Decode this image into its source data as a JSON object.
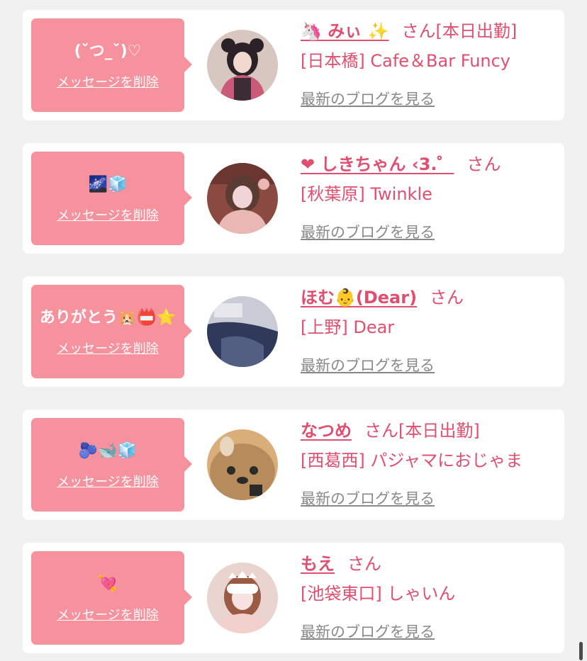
{
  "common": {
    "delete_label": "メッセージを削除",
    "blog_label": "最新のブログを見る",
    "san_label": "さん"
  },
  "items": [
    {
      "message": "(ˇつ_ˇ)♡",
      "name": "🦄 みぃ ✨",
      "status": "[本日出勤]",
      "shop": "[日本橋] Cafe＆Bar Funcy",
      "avatar_colors": [
        "#d8c6c1",
        "#2a2226",
        "#c95a7a"
      ]
    },
    {
      "message": "🌌🧊",
      "name": "❤ しきちゃん ‹3.゜",
      "status": "",
      "shop": "[秋葉原] Twinkle",
      "avatar_colors": [
        "#8a4a42",
        "#e9b8b4",
        "#f1d4d8"
      ]
    },
    {
      "message": "ありがとう🐹📛⭐",
      "name": "ほむ👶(Dear)",
      "status": "",
      "shop": "[上野] Dear",
      "avatar_colors": [
        "#2f3a5a",
        "#c9ccd6",
        "#525f82"
      ]
    },
    {
      "message": "🫐🐋🧊",
      "name": "なつめ",
      "status": "[本日出勤]",
      "shop": "[西葛西] パジャマにおじゃま",
      "avatar_colors": [
        "#d9ae7a",
        "#b78c5c",
        "#2a2a2a"
      ]
    },
    {
      "message": "💘",
      "name": "もえ",
      "status": "",
      "shop": "[池袋東口] しゃいん",
      "avatar_colors": [
        "#e9d4cf",
        "#9a5a44",
        "#f6e3df"
      ]
    }
  ]
}
